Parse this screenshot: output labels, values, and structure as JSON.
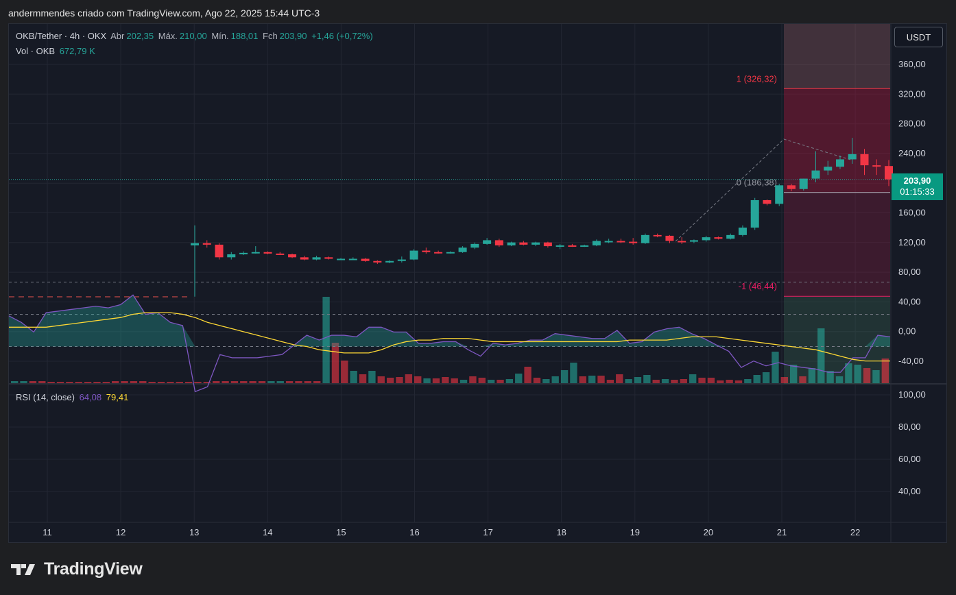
{
  "header": {
    "title": "andermmendes criado com TradingView.com, Ago 22, 2025 15:44 UTC-3"
  },
  "legend": {
    "symbol": "OKB/Tether · 4h · OKX",
    "open_label": "Abr",
    "open_value": "202,35",
    "high_label": "Máx.",
    "high_value": "210,00",
    "low_label": "Mín.",
    "low_value": "188,01",
    "close_label": "Fch",
    "close_value": "203,90",
    "change": "+1,46 (+0,72%)",
    "vol_label": "Vol · OKB",
    "vol_value": "672,79 K"
  },
  "currency_button": "USDT",
  "price_tag": {
    "price": "203,90",
    "countdown": "01:15:33"
  },
  "rsi_legend": {
    "label": "RSI (14, close)",
    "value1": "64,08",
    "value2": "79,41"
  },
  "logo": {
    "text": "TradingView"
  },
  "colors": {
    "up": "#26a69a",
    "down": "#f23645",
    "rsi": "#7e57c2",
    "rsi_ma": "#fdd835",
    "bg": "#161a25"
  },
  "chart_data": [
    {
      "type": "candlestick",
      "interval": "4h",
      "y_axis_labels": [
        "360,00",
        "320,00",
        "280,00",
        "240,00",
        "200,00",
        "160,00",
        "120,00",
        "80,00",
        "40,00",
        "0,00",
        "-40,00"
      ],
      "x_axis_labels": [
        "11",
        "12",
        "13",
        "14",
        "15",
        "16",
        "17",
        "18",
        "19",
        "20",
        "21",
        "22"
      ],
      "fibonacci": [
        {
          "label": "1 (326,32)",
          "price": 326.32
        },
        {
          "label": "0 (186,38)",
          "price": 186.38
        },
        {
          "label": "-1 (46,44)",
          "price": 46.44
        }
      ],
      "last_price": 203.9,
      "candles": [
        [
          115,
          142,
          46,
          118
        ],
        [
          118,
          122,
          112,
          116
        ],
        [
          116,
          118,
          96,
          99
        ],
        [
          99,
          106,
          96,
          103
        ],
        [
          103,
          107,
          102,
          105
        ],
        [
          105,
          114,
          104,
          106
        ],
        [
          106,
          107,
          103,
          104
        ],
        [
          104,
          106,
          102,
          103
        ],
        [
          103,
          104,
          98,
          99
        ],
        [
          99,
          101,
          95,
          96
        ],
        [
          96,
          101,
          95,
          99
        ],
        [
          99,
          100,
          96,
          97
        ],
        [
          97,
          98,
          96,
          97
        ],
        [
          97,
          99,
          96,
          97
        ],
        [
          97,
          98,
          93,
          94
        ],
        [
          94,
          95,
          90,
          92
        ],
        [
          92,
          95,
          91,
          94
        ],
        [
          94,
          100,
          92,
          96
        ],
        [
          96,
          110,
          95,
          108
        ],
        [
          108,
          112,
          104,
          106
        ],
        [
          106,
          108,
          104,
          105
        ],
        [
          105,
          107,
          104,
          106
        ],
        [
          106,
          114,
          105,
          112
        ],
        [
          112,
          119,
          110,
          117
        ],
        [
          117,
          125,
          116,
          122
        ],
        [
          122,
          124,
          113,
          115
        ],
        [
          115,
          120,
          114,
          119
        ],
        [
          119,
          121,
          115,
          116
        ],
        [
          116,
          120,
          114,
          119
        ],
        [
          119,
          120,
          112,
          114
        ],
        [
          114,
          117,
          110,
          115
        ],
        [
          115,
          117,
          113,
          114
        ],
        [
          114,
          116,
          113,
          115
        ],
        [
          115,
          123,
          114,
          121
        ],
        [
          121,
          124,
          118,
          121
        ],
        [
          121,
          124,
          118,
          120
        ],
        [
          120,
          125,
          116,
          118
        ],
        [
          118,
          131,
          117,
          129
        ],
        [
          129,
          131,
          126,
          128
        ],
        [
          128,
          129,
          118,
          121
        ],
        [
          121,
          126,
          117,
          120
        ],
        [
          120,
          123,
          118,
          122
        ],
        [
          122,
          128,
          120,
          126
        ],
        [
          126,
          127,
          123,
          124
        ],
        [
          124,
          131,
          123,
          129
        ],
        [
          129,
          142,
          127,
          139
        ],
        [
          139,
          179,
          136,
          176
        ],
        [
          176,
          177,
          169,
          171
        ],
        [
          171,
          198,
          168,
          196
        ],
        [
          196,
          198,
          188,
          191
        ],
        [
          191,
          205,
          189,
          205
        ],
        [
          205,
          242,
          200,
          216
        ],
        [
          216,
          229,
          210,
          221
        ],
        [
          221,
          236,
          218,
          231
        ],
        [
          231,
          260,
          225,
          238
        ],
        [
          238,
          245,
          210,
          223
        ],
        [
          223,
          231,
          210,
          222
        ],
        [
          222,
          230,
          195,
          204
        ]
      ],
      "volumes": [
        [
          3,
          "u"
        ],
        [
          3,
          "u"
        ],
        [
          3,
          "d"
        ],
        [
          3,
          "d"
        ],
        [
          2,
          "d"
        ],
        [
          2,
          "d"
        ],
        [
          2,
          "d"
        ],
        [
          2,
          "d"
        ],
        [
          2,
          "d"
        ],
        [
          2,
          "d"
        ],
        [
          2,
          "d"
        ],
        [
          3,
          "d"
        ],
        [
          3,
          "d"
        ],
        [
          3,
          "d"
        ],
        [
          3,
          "d"
        ],
        [
          2,
          "d"
        ],
        [
          2,
          "d"
        ],
        [
          2,
          "d"
        ],
        [
          2,
          "d"
        ],
        [
          2,
          "d"
        ],
        [
          2,
          "d"
        ],
        [
          2,
          "d"
        ],
        [
          3,
          "d"
        ],
        [
          3,
          "d"
        ],
        [
          3,
          "d"
        ],
        [
          3,
          "d"
        ],
        [
          3,
          "d"
        ],
        [
          3,
          "d"
        ],
        [
          3,
          "u"
        ],
        [
          3,
          "u"
        ],
        [
          3,
          "d"
        ],
        [
          3,
          "d"
        ],
        [
          3,
          "d"
        ],
        [
          3,
          "d"
        ],
        [
          126,
          "u"
        ],
        [
          59,
          "d"
        ],
        [
          33,
          "d"
        ],
        [
          18,
          "u"
        ],
        [
          13,
          "d"
        ],
        [
          18,
          "u"
        ],
        [
          10,
          "d"
        ],
        [
          8,
          "d"
        ],
        [
          9,
          "d"
        ],
        [
          13,
          "d"
        ],
        [
          10,
          "d"
        ],
        [
          7,
          "u"
        ],
        [
          7,
          "d"
        ],
        [
          9,
          "d"
        ],
        [
          7,
          "d"
        ],
        [
          5,
          "u"
        ],
        [
          10,
          "d"
        ],
        [
          8,
          "d"
        ],
        [
          5,
          "u"
        ],
        [
          5,
          "d"
        ],
        [
          6,
          "u"
        ],
        [
          14,
          "u"
        ],
        [
          24,
          "d"
        ],
        [
          8,
          "d"
        ],
        [
          6,
          "u"
        ],
        [
          10,
          "u"
        ],
        [
          19,
          "u"
        ],
        [
          30,
          "u"
        ],
        [
          10,
          "d"
        ],
        [
          11,
          "u"
        ],
        [
          11,
          "d"
        ],
        [
          5,
          "d"
        ],
        [
          13,
          "d"
        ],
        [
          6,
          "u"
        ],
        [
          9,
          "u"
        ],
        [
          12,
          "u"
        ],
        [
          5,
          "d"
        ],
        [
          6,
          "u"
        ],
        [
          5,
          "d"
        ],
        [
          6,
          "d"
        ],
        [
          13,
          "u"
        ],
        [
          8,
          "d"
        ],
        [
          8,
          "d"
        ],
        [
          4,
          "d"
        ],
        [
          5,
          "d"
        ],
        [
          4,
          "d"
        ],
        [
          6,
          "u"
        ],
        [
          12,
          "u"
        ],
        [
          16,
          "u"
        ],
        [
          46,
          "u"
        ],
        [
          9,
          "d"
        ],
        [
          27,
          "u"
        ],
        [
          10,
          "d"
        ],
        [
          22,
          "u"
        ],
        [
          80,
          "u"
        ],
        [
          18,
          "u"
        ],
        [
          10,
          "u"
        ],
        [
          29,
          "u"
        ],
        [
          27,
          "u"
        ],
        [
          22,
          "d"
        ],
        [
          19,
          "u"
        ],
        [
          36,
          "d"
        ]
      ]
    },
    {
      "type": "line",
      "name": "RSI (14, close)",
      "y_axis_labels": [
        "100,00",
        "80,00",
        "60,00",
        "40,00"
      ],
      "levels": [
        70,
        50,
        30
      ],
      "rsi": [
        51,
        55,
        61,
        49,
        48,
        47,
        46,
        45,
        46,
        44,
        38,
        50,
        49,
        55,
        57,
        98,
        95,
        75,
        77,
        77,
        77,
        76,
        75,
        69,
        63,
        66,
        63,
        63,
        64,
        58,
        58,
        61,
        61,
        68,
        68,
        67,
        67,
        72,
        76,
        68,
        69,
        68,
        66,
        66,
        62,
        63,
        64,
        65,
        65,
        60,
        68,
        67,
        61,
        59,
        58,
        62,
        65,
        69,
        73,
        83,
        79,
        82,
        80,
        82,
        83,
        84,
        86,
        86,
        77,
        77,
        63,
        64
      ],
      "rsi_ma": [
        58,
        58,
        58,
        58,
        57,
        56,
        55,
        54,
        53,
        52,
        50,
        49,
        49,
        49,
        50,
        52,
        55,
        57,
        59,
        61,
        63,
        65,
        67,
        69,
        70,
        72,
        73,
        74,
        74,
        74,
        72,
        69,
        67,
        66,
        66,
        65,
        65,
        65,
        66,
        67,
        67,
        67,
        67,
        67,
        67,
        67,
        67,
        67,
        67,
        67,
        66,
        66,
        66,
        66,
        65,
        64,
        64,
        64,
        65,
        66,
        67,
        68,
        69,
        70,
        71,
        72,
        74,
        76,
        78,
        79,
        79,
        79
      ]
    }
  ]
}
